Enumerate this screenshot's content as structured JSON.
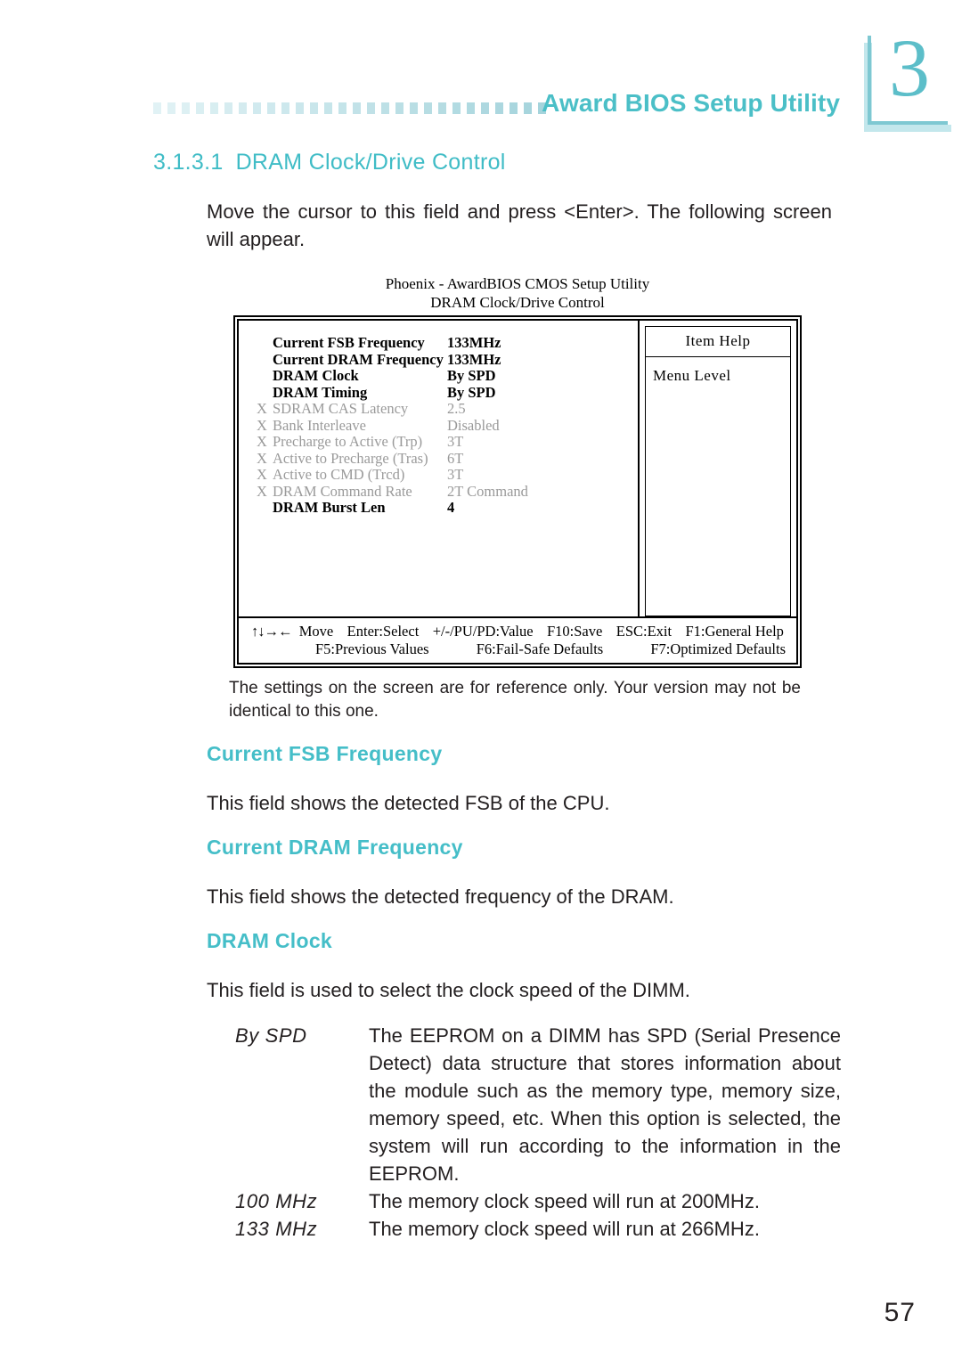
{
  "header": {
    "title": "Award BIOS Setup Utility",
    "chapter": "3",
    "dot_count": 28,
    "accent_color": "#4bbfc7",
    "dot_color": "#cdeef2"
  },
  "section": {
    "number": "3.1.3.1",
    "title": "DRAM Clock/Drive Control",
    "intro": "Move the cursor to this field and press <Enter>. The following screen will appear."
  },
  "bios_screen": {
    "caption_line1": "Phoenix - AwardBIOS CMOS Setup Utility",
    "caption_line2": "DRAM Clock/Drive Control",
    "help_title": "Item  Help",
    "help_body": "Menu  Level",
    "rows": [
      {
        "mark": "",
        "label": "Current  FSB  Frequency",
        "value": "133MHz",
        "state": "active"
      },
      {
        "mark": "",
        "label": "Current  DRAM  Frequency",
        "value": "133MHz",
        "state": "active"
      },
      {
        "mark": "",
        "label": "DRAM Clock",
        "value": "By  SPD",
        "state": "active"
      },
      {
        "mark": "",
        "label": "DRAM Timing",
        "value": "By  SPD",
        "state": "active"
      },
      {
        "mark": "X",
        "label": "SDRAM  CAS  Latency",
        "value": "2.5",
        "state": "dim"
      },
      {
        "mark": "X",
        "label": "Bank  Interleave",
        "value": "Disabled",
        "state": "dim"
      },
      {
        "mark": "X",
        "label": "Precharge  to  Active  (Trp)",
        "value": "3T",
        "state": "dim"
      },
      {
        "mark": "X",
        "label": "Active  to  Precharge  (Tras)",
        "value": "6T",
        "state": "dim"
      },
      {
        "mark": "X",
        "label": "Active  to  CMD  (Trcd)",
        "value": "3T",
        "state": "dim"
      },
      {
        "mark": "X",
        "label": "DRAM  Command  Rate",
        "value": "2T  Command",
        "state": "dim"
      },
      {
        "mark": "",
        "label": "DRAM Burst Len",
        "value": "4",
        "state": "active"
      }
    ],
    "footer": {
      "arrows": "↑↓→←",
      "move": "Move",
      "enter": "Enter:Select",
      "value": "+/-/PU/PD:Value",
      "save": "F10:Save",
      "exit": "ESC:Exit",
      "general_help": "F1:General Help",
      "previous_values": "F5:Previous Values",
      "fail_safe": "F6:Fail-Safe Defaults",
      "optimized": "F7:Optimized Defaults"
    }
  },
  "disclaimer": "The settings on the screen are for reference only. Your version may not be identical to this one.",
  "fields": [
    {
      "heading": "Current FSB Frequency",
      "body": "This field shows the detected FSB of the CPU."
    },
    {
      "heading": "Current DRAM Frequency",
      "body": "This field shows the detected frequency of the DRAM."
    },
    {
      "heading": "DRAM Clock",
      "body": "This field is used to select the clock speed of the DIMM."
    }
  ],
  "options": [
    {
      "term": "By SPD",
      "definition": "The EEPROM on a DIMM has SPD (Serial Presence Detect) data structure that stores information about the module such as the memory type, memory size, memory speed, etc. When this option is selected, the system will run according to the information in the EEPROM."
    },
    {
      "term": "100 MHz",
      "definition": "The memory clock speed will run at 200MHz."
    },
    {
      "term": "133 MHz",
      "definition": "The memory clock speed will run at 266MHz."
    }
  ],
  "page_number": "57"
}
